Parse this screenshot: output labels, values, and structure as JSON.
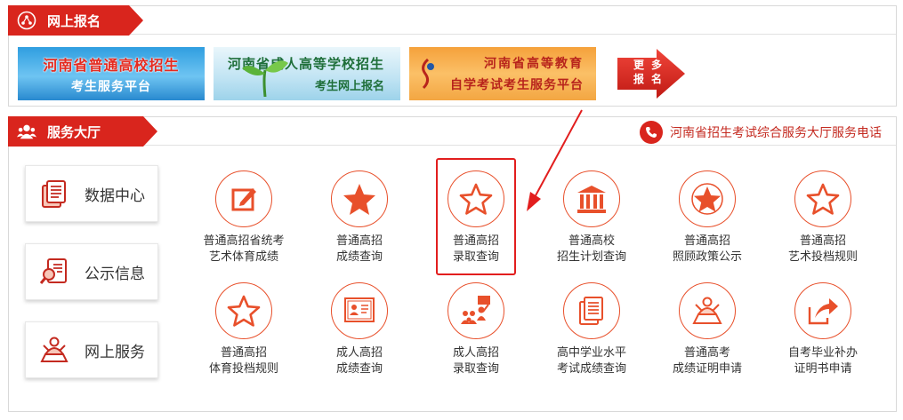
{
  "registration": {
    "title": "网上报名",
    "banners": [
      {
        "line1": "河南省普通高校招生",
        "line2": "考生服务平台"
      },
      {
        "line1": "河南省成人高等学校招生",
        "line2": "考生网上报名"
      },
      {
        "line1": "河南省高等教育",
        "line2": "自学考试考生服务平台"
      }
    ],
    "more": [
      "更",
      "多",
      "报",
      "名"
    ]
  },
  "service_hall": {
    "title": "服务大厅",
    "hotline": "河南省招生考试综合服务大厅服务电话",
    "side_nav": [
      {
        "label": "数据中心",
        "icon": "document-stack-icon"
      },
      {
        "label": "公示信息",
        "icon": "search-document-icon"
      },
      {
        "label": "网上服务",
        "icon": "person-desk-icon"
      }
    ],
    "services": [
      {
        "line1": "普通高招省统考",
        "line2": "艺术体育成绩",
        "icon": "edit-note-icon"
      },
      {
        "line1": "普通高招",
        "line2": "成绩查询",
        "icon": "star-filled-icon"
      },
      {
        "line1": "普通高招",
        "line2": "录取查询",
        "icon": "star-outline-icon"
      },
      {
        "line1": "普通高校",
        "line2": "招生计划查询",
        "icon": "building-icon"
      },
      {
        "line1": "普通高招",
        "line2": "照顾政策公示",
        "icon": "star-badge-icon"
      },
      {
        "line1": "普通高招",
        "line2": "艺术投档规则",
        "icon": "star-outline-icon"
      },
      {
        "line1": "普通高招",
        "line2": "体育投档规则",
        "icon": "star-outline-icon"
      },
      {
        "line1": "成人高招",
        "line2": "成绩查询",
        "icon": "certificate-icon"
      },
      {
        "line1": "成人高招",
        "line2": "录取查询",
        "icon": "presentation-icon"
      },
      {
        "line1": "高中学业水平",
        "line2": "考试成绩查询",
        "icon": "document-stack-icon"
      },
      {
        "line1": "普通高考",
        "line2": "成绩证明申请",
        "icon": "person-desk-icon"
      },
      {
        "line1": "自考毕业补办",
        "line2": "证明书申请",
        "icon": "export-arrow-icon"
      }
    ]
  },
  "colors": {
    "brand_red": "#d9251d",
    "icon_orange": "#e8502b"
  }
}
